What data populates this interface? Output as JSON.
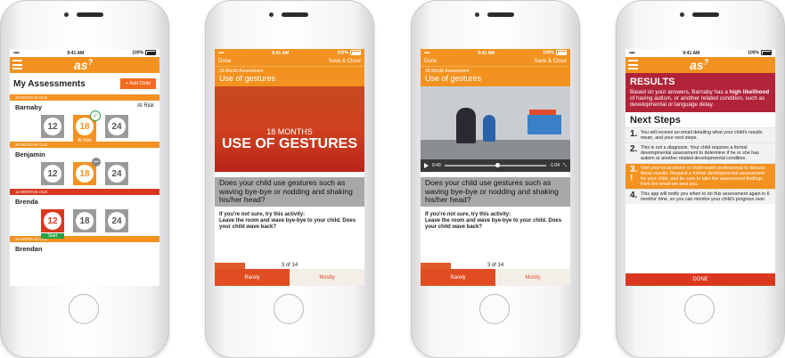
{
  "status": {
    "signal": "•••••",
    "time": "9:41 AM",
    "battery": "100%"
  },
  "logo": "as",
  "screen1": {
    "title": "My Assessments",
    "add_child": "+ Add Child",
    "children": [
      {
        "age": "20 MONTHS OLD",
        "name": "Barnaby",
        "risk": "At Risk",
        "tiles": [
          {
            "num": "12",
            "label": ""
          },
          {
            "num": "18",
            "label": "At Risk"
          },
          {
            "num": "24",
            "label": ""
          }
        ]
      },
      {
        "age": "20 MONTHS OLD",
        "name": "Benjamin",
        "risk": "",
        "tiles": [
          {
            "num": "12",
            "label": ""
          },
          {
            "num": "18",
            "label": ""
          },
          {
            "num": "24",
            "label": ""
          }
        ]
      },
      {
        "age": "12 MONTHS OLD",
        "name": "Brenda",
        "risk": "",
        "tiles": [
          {
            "num": "12",
            "label": "Start"
          },
          {
            "num": "18",
            "label": ""
          },
          {
            "num": "24",
            "label": ""
          }
        ]
      },
      {
        "age": "20 MONTHS OLD",
        "name": "Brendan",
        "risk": ""
      }
    ]
  },
  "screen2": {
    "done": "Done",
    "save_close": "Save & Close",
    "subtitle": "18-Month Assessment",
    "title": "Use of gestures",
    "hero_line1": "18 MONTHS",
    "hero_line2": "USE OF GESTURES",
    "question": "Does your child use gestures such as waving bye-bye or nodding and shaking his/her head?",
    "hint": "If you're not sure, try this activity:\nLeave the room and wave bye-bye to your child. Does your child wave back?",
    "progress": "3 of 14",
    "progress_fraction": 0.2,
    "answer_left": "Rarely",
    "answer_right": "Mostly"
  },
  "screen3": {
    "done": "Done",
    "save_close": "Save & Close",
    "subtitle": "18-Month Assessment",
    "title": "Use of gestures",
    "video_elapsed": "0:49",
    "video_remaining": "-1:04",
    "question": "Does your child use gestures such as waving bye-bye or nodding and shaking his/her head?",
    "hint": "If you're not sure, try this activity:\nLeave the room and wave bye-bye to your child. Does your child wave back?",
    "progress": "3 of 14",
    "answer_left": "Rarely",
    "answer_right": "Mostly"
  },
  "screen4": {
    "results_title": "RESULTS",
    "results_pre": "Based on your answers, Barnaby has a ",
    "results_bold": "high likelihood",
    "results_post": " of having autism, or another related condition, such as developmental or language delay.",
    "next_steps": "Next Steps",
    "steps": [
      {
        "n": "1.",
        "text": "You will receive an email detailing what your child's results mean, and your next steps."
      },
      {
        "n": "2.",
        "text": "This is not a diagnosis. Your child requires a formal developmental assessment to determine if he or she has autism or another related developmental condition."
      },
      {
        "n": "3.",
        "text": "Visit your local doctor or child health professional to discuss these results. Request a formal developmental assessment for your child, and be sure to take the assessment findings from the email we sent you."
      },
      {
        "n": "4.",
        "text": "This app will notify you when to do this assessment again in 6 months' time, so you can monitor your child's progress over"
      }
    ],
    "done": "DONE"
  },
  "colors": {
    "orange": "#f39220",
    "red": "#d9381e",
    "results_red": "#b2233a",
    "green": "#27a244"
  }
}
